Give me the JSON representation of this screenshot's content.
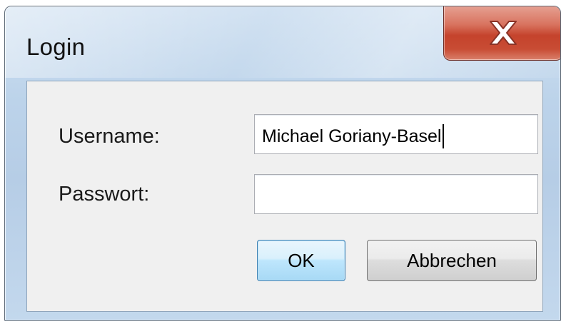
{
  "window": {
    "title": "Login",
    "close_symbol": "X"
  },
  "form": {
    "username_label": "Username:",
    "username_value": "Michael Goriany-Basel",
    "password_label": "Passwort:",
    "password_value": ""
  },
  "buttons": {
    "ok_label": "OK",
    "cancel_label": "Abbrechen"
  },
  "icons": {
    "close": "close-icon"
  },
  "colors": {
    "title_bar": "#bcd3ea",
    "close_button": "#c5432c",
    "default_button_border": "#3c7fb1"
  }
}
